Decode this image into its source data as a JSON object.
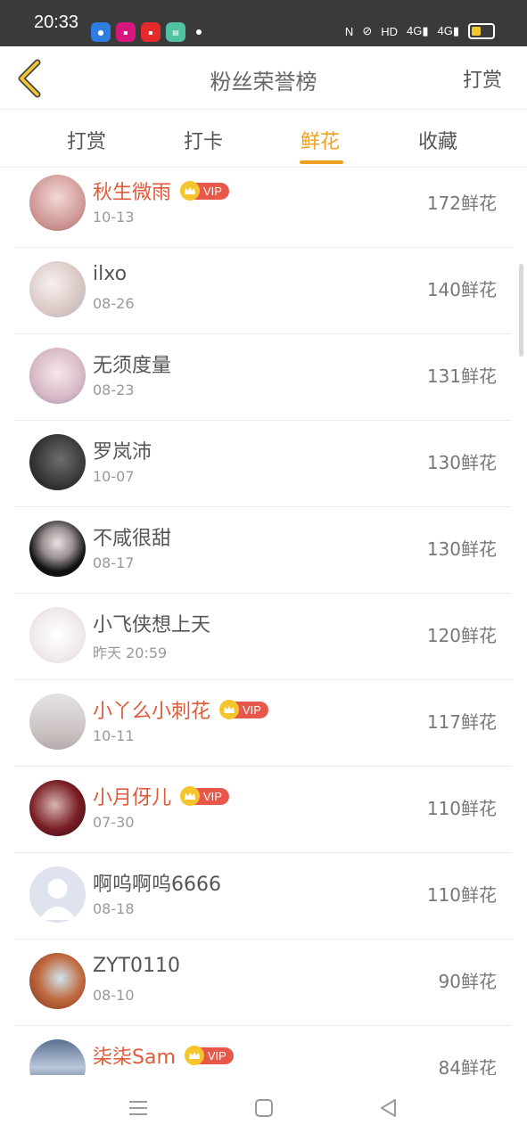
{
  "status": {
    "time": "20:33",
    "network": "HD",
    "sig1": "4G",
    "sig2": "4G"
  },
  "nav": {
    "title": "粉丝荣誉榜",
    "right": "打赏"
  },
  "tabs": [
    {
      "label": "打赏"
    },
    {
      "label": "打卡"
    },
    {
      "label": "鲜花"
    },
    {
      "label": "收藏"
    }
  ],
  "vip_label": "VIP",
  "list": [
    {
      "name": "秋生微雨",
      "vip": true,
      "date": "10-13",
      "count": "172鲜花"
    },
    {
      "name": "ilxo",
      "vip": false,
      "date": "08-26",
      "count": "140鲜花"
    },
    {
      "name": "无须度量",
      "vip": false,
      "date": "08-23",
      "count": "131鲜花"
    },
    {
      "name": "罗岚沛",
      "vip": false,
      "date": "10-07",
      "count": "130鲜花"
    },
    {
      "name": "不咸很甜",
      "vip": false,
      "date": "08-17",
      "count": "130鲜花"
    },
    {
      "name": "小飞侠想上天",
      "vip": false,
      "date": "昨天 20:59",
      "count": "120鲜花"
    },
    {
      "name": "小丫么小刺花",
      "vip": true,
      "date": "10-11",
      "count": "117鲜花"
    },
    {
      "name": "小月伢儿",
      "vip": true,
      "date": "07-30",
      "count": "110鲜花"
    },
    {
      "name": "啊呜啊呜6666",
      "vip": false,
      "date": "08-18",
      "count": "110鲜花"
    },
    {
      "name": "ZYT0110",
      "vip": false,
      "date": "08-10",
      "count": "90鲜花"
    },
    {
      "name": "柒柒Sam",
      "vip": true,
      "date": "",
      "count": "84鲜花"
    }
  ],
  "colors": {
    "accent": "#f0a020",
    "vip_name": "#e05a3a",
    "vip_badge": "#e8584a"
  }
}
